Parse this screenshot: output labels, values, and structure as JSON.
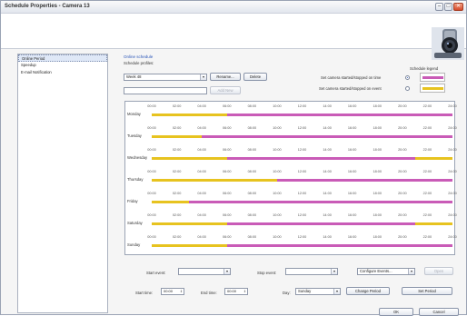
{
  "window": {
    "title": "Schedule Properties - Camera 13"
  },
  "sidebar": {
    "items": [
      {
        "label": "Online Period",
        "active": true
      },
      {
        "label": "Speedup",
        "active": false
      },
      {
        "label": "E-mail Notification",
        "active": false
      }
    ]
  },
  "schedule": {
    "group_title": "Online schedule",
    "profiles_label": "Schedule profiles:",
    "profile_value": "Week 48",
    "rename_label": "Rename...",
    "delete_label": "Delete",
    "add_new_label": "Add New",
    "legend": {
      "title": "Schedule legend",
      "item_time": "Set camera started/stopped on time",
      "item_event": "Set camera started/stopped on event",
      "color_time": "#c95bb7",
      "color_event": "#e7c31f",
      "selected": "time"
    }
  },
  "hours": [
    "00:00",
    "02:00",
    "04:00",
    "06:00",
    "08:00",
    "10:00",
    "12:00",
    "14:00",
    "16:00",
    "18:00",
    "20:00",
    "22:00",
    "24:00"
  ],
  "days": [
    {
      "name": "Monday",
      "segments": [
        {
          "mode": "event",
          "from": 0,
          "to": 6
        },
        {
          "mode": "time",
          "from": 6,
          "to": 24
        }
      ]
    },
    {
      "name": "Tuesday",
      "segments": [
        {
          "mode": "event",
          "from": 0,
          "to": 4
        },
        {
          "mode": "time",
          "from": 4,
          "to": 24
        }
      ]
    },
    {
      "name": "Wednesday",
      "segments": [
        {
          "mode": "event",
          "from": 0,
          "to": 6
        },
        {
          "mode": "time",
          "from": 6,
          "to": 21
        },
        {
          "mode": "event",
          "from": 21,
          "to": 24
        }
      ]
    },
    {
      "name": "Thursday",
      "segments": [
        {
          "mode": "event",
          "from": 0,
          "to": 10
        },
        {
          "mode": "time",
          "from": 10,
          "to": 24
        }
      ]
    },
    {
      "name": "Friday",
      "segments": [
        {
          "mode": "event",
          "from": 0,
          "to": 3
        },
        {
          "mode": "time",
          "from": 3,
          "to": 24
        }
      ]
    },
    {
      "name": "Saturday",
      "segments": [
        {
          "mode": "event",
          "from": 0,
          "to": 6
        },
        {
          "mode": "time",
          "from": 6,
          "to": 21
        },
        {
          "mode": "event",
          "from": 21,
          "to": 24
        }
      ]
    },
    {
      "name": "Sunday",
      "segments": [
        {
          "mode": "event",
          "from": 0,
          "to": 6
        },
        {
          "mode": "time",
          "from": 6,
          "to": 24
        }
      ]
    }
  ],
  "controls": {
    "start_event_label": "Start event:",
    "start_event_value": "",
    "stop_event_label": "Stop event:",
    "stop_event_value": "",
    "configure_events_label": "Configure Events...",
    "open_label": "Open",
    "start_time_label": "Start time:",
    "start_time_value": "00:00",
    "end_time_label": "End time:",
    "end_time_value": "00:00",
    "day_label": "Day:",
    "day_value": "Sunday",
    "change_period_label": "Change Period",
    "set_period_label": "Set Period"
  },
  "footer": {
    "ok_label": "OK",
    "cancel_label": "Cancel"
  }
}
